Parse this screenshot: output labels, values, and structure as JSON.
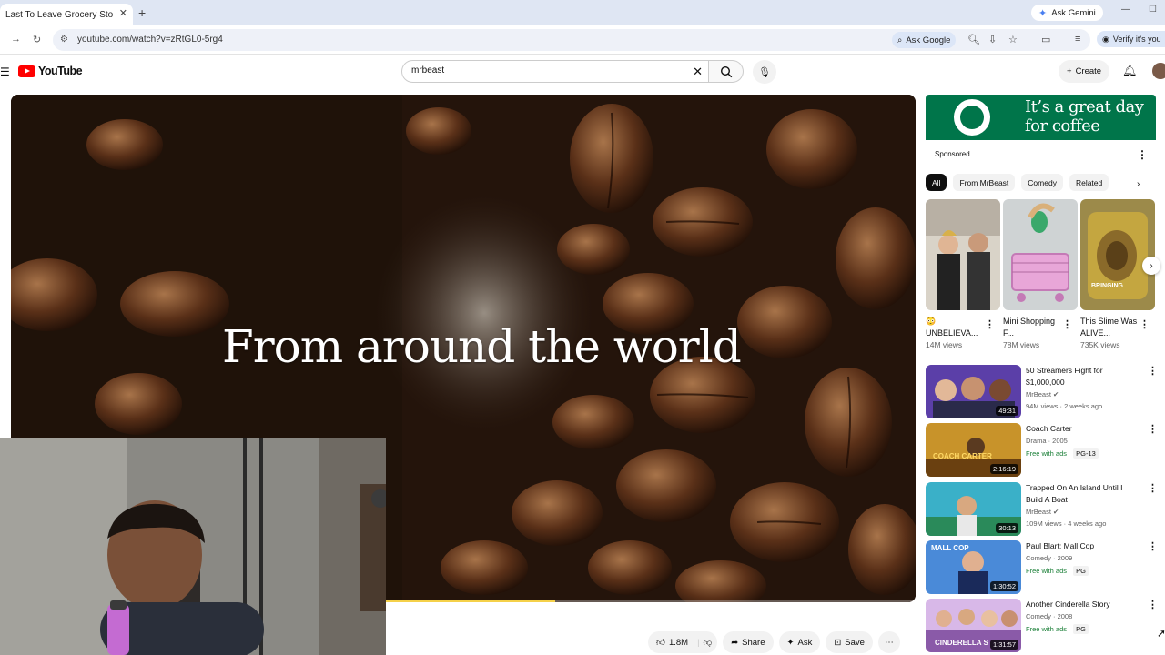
{
  "browser": {
    "tab_title": "Last To Leave Grocery Store, Wi",
    "tab_close": "✕",
    "new_tab": "+",
    "gemini_label": "Ask Gemini",
    "url": "youtube.com/watch?v=zRtGL0-5rg4",
    "ask_google": "Ask Google",
    "verify_label": "Verify it's you"
  },
  "header": {
    "logo_text": "YouTube",
    "search_value": "mrbeast",
    "create_label": "Create"
  },
  "video": {
    "caption": "From around the world",
    "progress": 0.32
  },
  "actions": {
    "likes": "1.8M",
    "share": "Share",
    "ask": "Ask",
    "save": "Save"
  },
  "ad": {
    "headline": "It’s a great day for coffee",
    "sponsored": "Sponsored",
    "brand_color": "#00754a"
  },
  "chips": [
    "All",
    "From MrBeast",
    "Comedy",
    "Related"
  ],
  "shorts": [
    {
      "title": "😳 UNBELIEVA...",
      "views": "14M views"
    },
    {
      "title": "Mini Shopping F...",
      "views": "78M views"
    },
    {
      "title": "This Slime Was ALIVE...",
      "views": "735K views",
      "thumb_text": "BRINGING"
    }
  ],
  "recommendations": [
    {
      "title": "50 Streamers Fight for $1,000,000",
      "channel": "MrBeast",
      "verified": true,
      "meta": "94M views · 2 weeks ago",
      "duration": "49:31"
    },
    {
      "title": "Coach Carter",
      "channel": "Drama · 2005",
      "badges": [
        "Free with ads",
        "PG-13"
      ],
      "duration": "2:16:19",
      "thumb_text": "COACH CARTER"
    },
    {
      "title": "Trapped On An Island Until I Build A Boat",
      "channel": "MrBeast",
      "verified": true,
      "meta": "109M views · 4 weeks ago",
      "duration": "30:13"
    },
    {
      "title": "Paul Blart: Mall Cop",
      "channel": "Comedy · 2009",
      "badges": [
        "Free with ads",
        "PG"
      ],
      "duration": "1:30:52",
      "thumb_text": "MALL COP"
    },
    {
      "title": "Another Cinderella Story",
      "channel": "Comedy · 2008",
      "badges": [
        "Free with ads",
        "PG"
      ],
      "duration": "1:31:57",
      "thumb_text": "CINDERELLA S"
    }
  ]
}
